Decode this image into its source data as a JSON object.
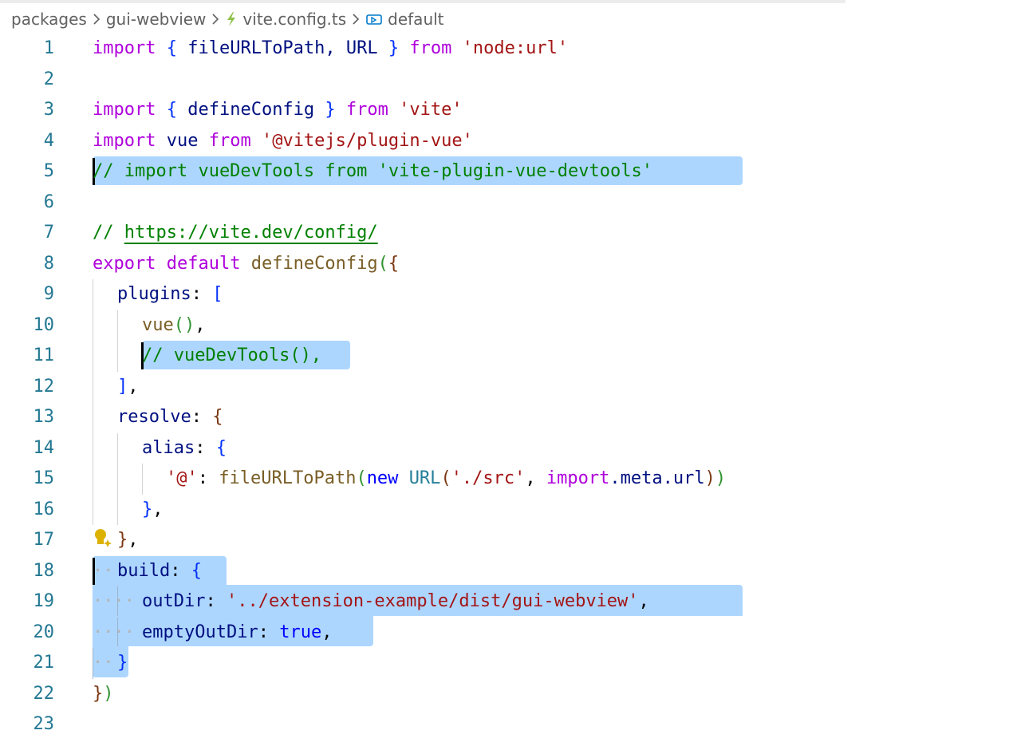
{
  "breadcrumb": {
    "folder1": "packages",
    "folder2": "gui-webview",
    "file": "vite.config.ts",
    "symbol": "default"
  },
  "editor": {
    "line_numbers": [
      "1",
      "2",
      "3",
      "4",
      "5",
      "6",
      "7",
      "8",
      "9",
      "10",
      "11",
      "12",
      "13",
      "14",
      "15",
      "16",
      "17",
      "18",
      "19",
      "20",
      "21",
      "22",
      "23"
    ],
    "l1": {
      "import": "import",
      "ob": "{",
      "names": " fileURLToPath, URL ",
      "cb": "}",
      "from": "from",
      "src": "'node:url'"
    },
    "l3": {
      "import": "import",
      "ob": "{",
      "names": " defineConfig ",
      "cb": "}",
      "from": "from",
      "src": "'vite'"
    },
    "l4": {
      "import": "import",
      "name": " vue ",
      "from": "from",
      "src": "'@vitejs/plugin-vue'"
    },
    "l5": {
      "comment": "// import vueDevTools from 'vite-plugin-vue-devtools'"
    },
    "l7": {
      "comment": "// ",
      "url": "https://vite.dev/config/"
    },
    "l8": {
      "export": "export",
      "default": "default",
      "fn": "defineConfig",
      "p": "(",
      "b": "{"
    },
    "l9": {
      "key": "plugins",
      "colon": ": ",
      "b": "["
    },
    "l10": {
      "fn": "vue",
      "p": "()",
      "comma": ","
    },
    "l11": {
      "comment": "// vueDevTools(),"
    },
    "l12": {
      "b": "]",
      "comma": ","
    },
    "l13": {
      "key": "resolve",
      "colon": ": ",
      "b": "{"
    },
    "l14": {
      "key": "alias",
      "colon": ": ",
      "b": "{"
    },
    "l15": {
      "key": "'@'",
      "colon": ": ",
      "fn": "fileURLToPath",
      "p1": "(",
      "new": "new",
      "cls": "URL",
      "p2": "(",
      "path": "'./src'",
      "comma": ", ",
      "imp": "import",
      "meta": ".meta.url",
      "p3": ")",
      "p4": ")"
    },
    "l16": {
      "b": "}",
      "comma": ","
    },
    "l17": {
      "b": "}",
      "comma": ","
    },
    "l18": {
      "key": "build",
      "colon": ": ",
      "b": "{"
    },
    "l19": {
      "key": "outDir",
      "colon": ": ",
      "val": "'../extension-example/dist/gui-webview'",
      "comma": ","
    },
    "l20": {
      "key": "emptyOutDir",
      "colon": ": ",
      "val": "true",
      "comma": ","
    },
    "l21": {
      "b": "}"
    },
    "l22": {
      "b": "}",
      "p": ")"
    }
  },
  "colors": {
    "keyword": "#af00db",
    "string": "#a31515",
    "comment": "#008000",
    "selection": "#add6ff",
    "line_number": "#237893"
  },
  "icons": [
    "chevron-right-icon",
    "typescript-file-icon",
    "symbol-icon",
    "lightbulb-sparkle-icon"
  ]
}
